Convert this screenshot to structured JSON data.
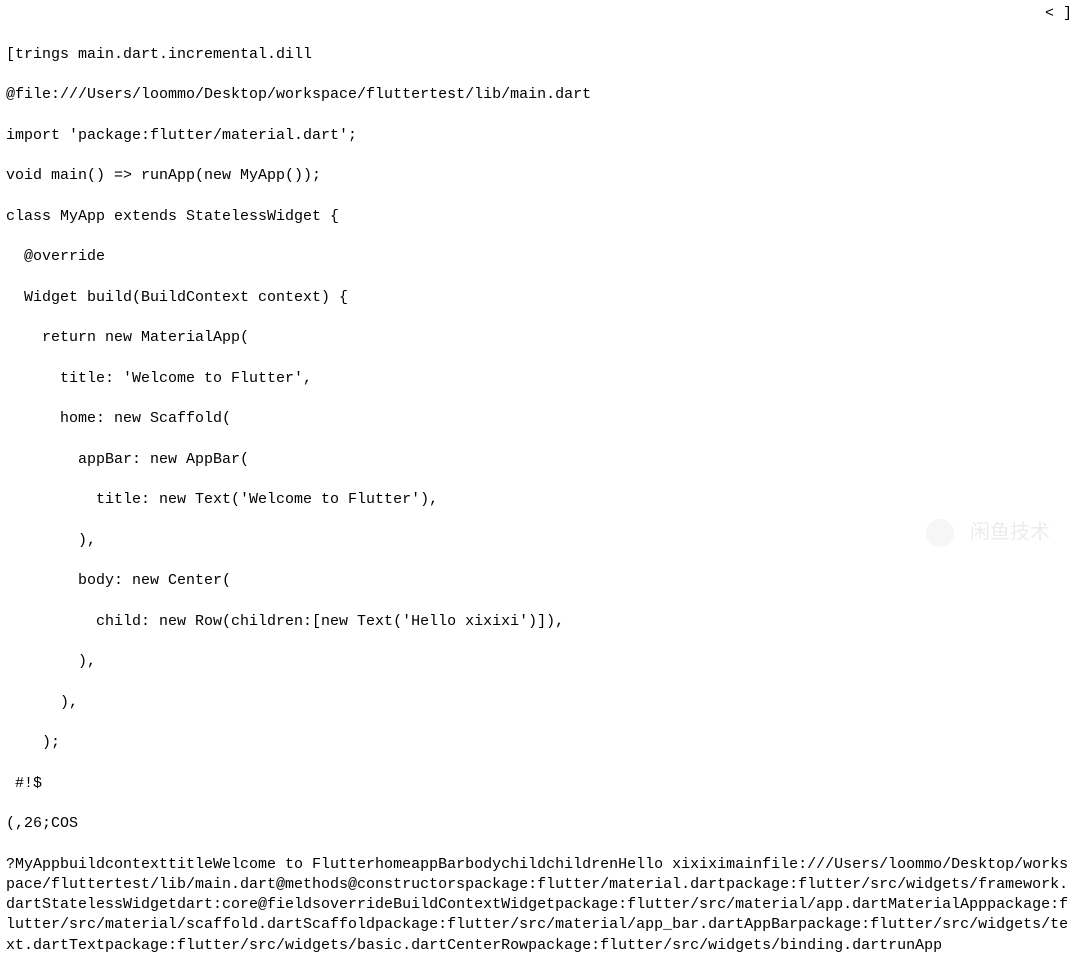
{
  "top_right": "< ]",
  "code": {
    "line1": "[trings main.dart.incremental.dill",
    "line2": "@file:///Users/loommo/Desktop/workspace/fluttertest/lib/main.dart",
    "line3": "import 'package:flutter/material.dart';",
    "line4": "void main() => runApp(new MyApp());",
    "line5": "class MyApp extends StatelessWidget {",
    "line6": "  @override",
    "line7": "  Widget build(BuildContext context) {",
    "line8": "    return new MaterialApp(",
    "line9": "      title: 'Welcome to Flutter',",
    "line10": "      home: new Scaffold(",
    "line11": "        appBar: new AppBar(",
    "line12": "          title: new Text('Welcome to Flutter'),",
    "line13": "        ),",
    "line14": "        body: new Center(",
    "line15": "          child: new Row(children:[new Text('Hello xixixi')]),",
    "line16": "        ),",
    "line17": "      ),",
    "line18": "    );",
    "line19": " #!$",
    "line20": "(,26;COS",
    "dump": "?MyAppbuildcontexttitleWelcome to FlutterhomeappBarbodychildchildrenHello xixiximainfile:///Users/loommo/Desktop/workspace/fluttertest/lib/main.dart@methods@constructorspackage:flutter/material.dartpackage:flutter/src/widgets/framework.dartStatelessWidgetdart:core@fieldsoverrideBuildContextWidgetpackage:flutter/src/material/app.dartMaterialApppackage:flutter/src/material/scaffold.dartScaffoldpackage:flutter/src/material/app_bar.dartAppBarpackage:flutter/src/widgets/text.dartTextpackage:flutter/src/widgets/basic.dartCenterRowpackage:flutter/src/widgets/binding.dartrunApp"
  },
  "watermark_text": "闲鱼技术"
}
